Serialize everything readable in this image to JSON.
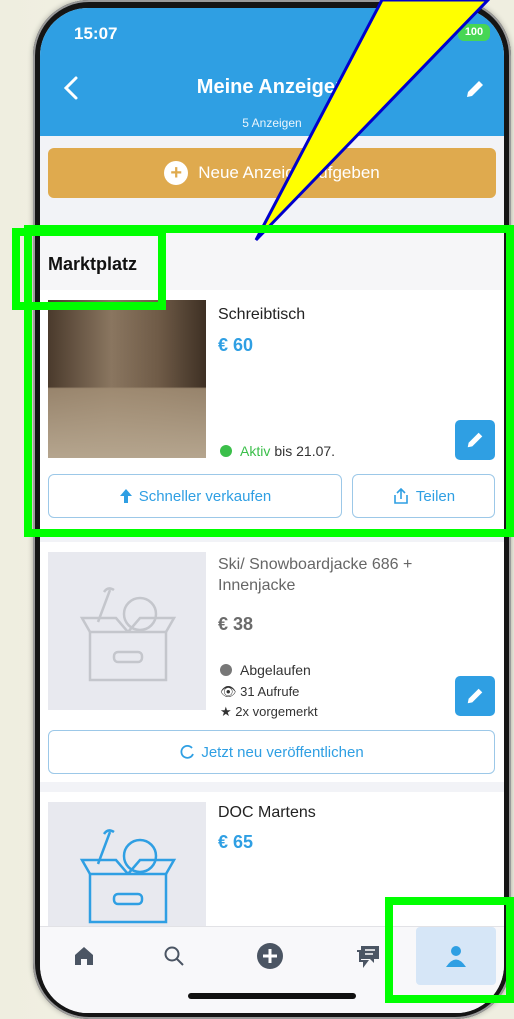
{
  "status_bar": {
    "time": "15:07",
    "battery": "100"
  },
  "header": {
    "title": "Meine Anzeigen",
    "subtitle": "5 Anzeigen"
  },
  "new_ad_button": {
    "label": "Neue Anzeige aufgeben"
  },
  "section": {
    "title": "Marktplatz"
  },
  "listings": [
    {
      "title": "Schreibtisch",
      "price": "€ 60",
      "status_label": "Aktiv",
      "status_suffix": "bis 21.07.",
      "status_color": "#3bbf4a",
      "sell_faster_label": "Schneller verkaufen",
      "share_label": "Teilen"
    },
    {
      "title": "Ski/ Snowboardjacke 686 + Innenjacke",
      "price": "€ 38",
      "status_label": "Abgelaufen",
      "status_color": "#777777",
      "views": "31 Aufrufe",
      "bookmarks": "2x vorgemerkt",
      "republish_label": "Jetzt neu veröffentlichen"
    },
    {
      "title": "DOC Martens",
      "price": "€ 65"
    }
  ],
  "tabbar": {
    "items": [
      "home-icon",
      "search-icon",
      "add-icon",
      "messages-icon",
      "profile-icon"
    ],
    "active": "profile-icon"
  },
  "colors": {
    "primary": "#2f9fe3",
    "accent": "#dfaa4e",
    "highlight": "#00ff00",
    "beam": "#ffff00"
  }
}
